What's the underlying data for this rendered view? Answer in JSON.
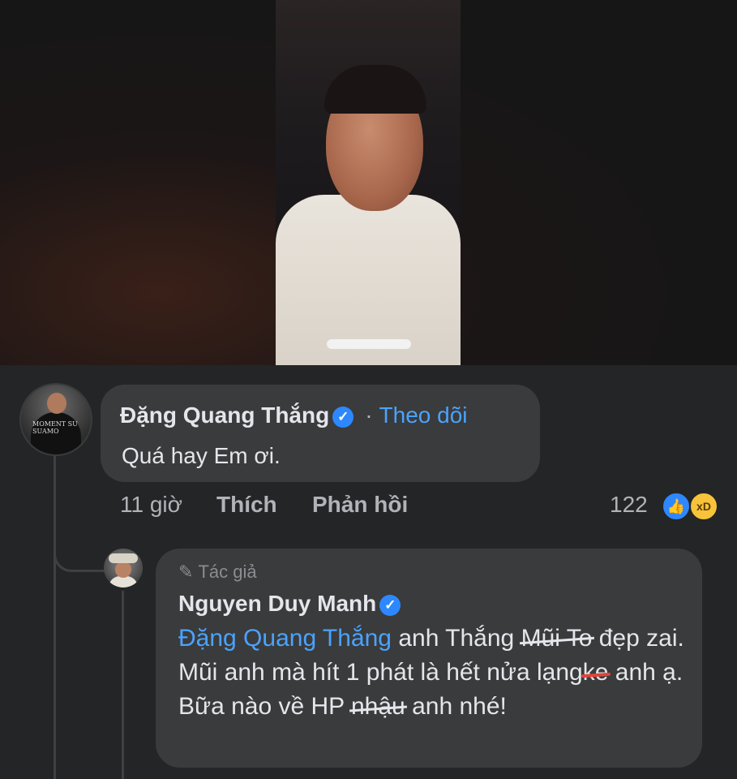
{
  "comment": {
    "author_name": "Đặng Quang Thắng",
    "follow_separator": "·",
    "follow_label": "Theo dõi",
    "text": "Quá hay Em ơi.",
    "time": "11 giờ",
    "like_label": "Thích",
    "reply_label": "Phản hồi",
    "reaction_count": "122",
    "reactions": [
      "like-icon",
      "haha-icon"
    ],
    "avatar_text": "MOMENT SU SUAMO"
  },
  "reply": {
    "badge_label": "Tác giả",
    "author_name": "Nguyen Duy Manh",
    "mention": "Đặng Quang Thắng",
    "text_1": " anh Thắng ",
    "strike_1": "Mũi To",
    "text_2": " đẹp zai. Mũi anh mà hít 1 phát là hết nửa lạng",
    "strike_2": " ke",
    "text_3": " anh ạ. Bữa nào về HP ",
    "strike_3": "nhậu",
    "text_4": " anh nhé!"
  },
  "colors": {
    "background": "#18191a",
    "comment_panel": "#242526",
    "bubble": "#3a3b3c",
    "link": "#4aa3ff",
    "verified": "#2d88ff"
  }
}
